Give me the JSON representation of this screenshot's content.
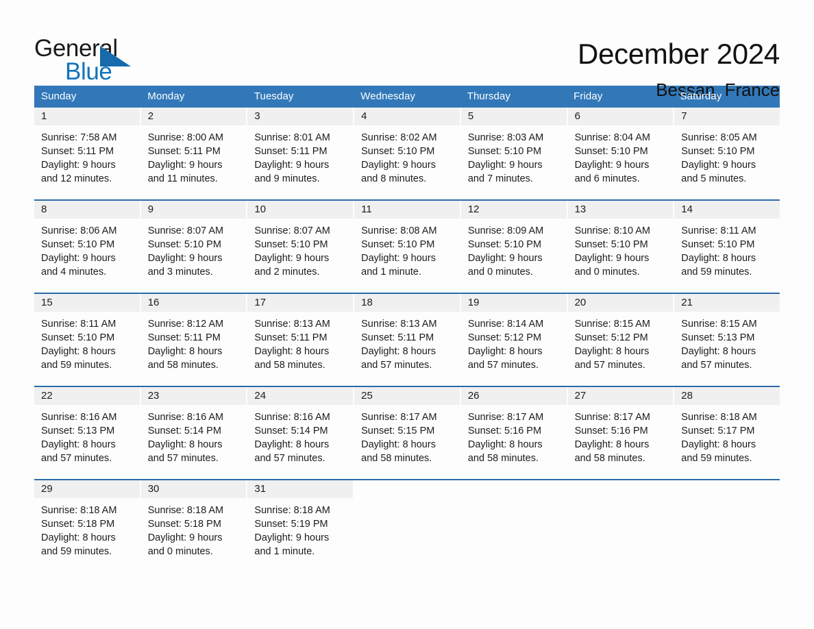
{
  "brand": {
    "name_part1": "General",
    "name_part2": "Blue",
    "accent_color": "#176aab",
    "blue_text_color": "#1273bd"
  },
  "header": {
    "month_title": "December 2024",
    "location": "Bessan, France"
  },
  "calendar": {
    "header_bg": "#3278b8",
    "row_divider_color": "#2b6ca8",
    "daynum_band_bg": "#f0f0f0",
    "weekdays": [
      "Sunday",
      "Monday",
      "Tuesday",
      "Wednesday",
      "Thursday",
      "Friday",
      "Saturday"
    ],
    "weeks": [
      [
        {
          "day": "1",
          "sunrise": "Sunrise: 7:58 AM",
          "sunset": "Sunset: 5:11 PM",
          "daylight_line1": "Daylight: 9 hours",
          "daylight_line2": "and 12 minutes."
        },
        {
          "day": "2",
          "sunrise": "Sunrise: 8:00 AM",
          "sunset": "Sunset: 5:11 PM",
          "daylight_line1": "Daylight: 9 hours",
          "daylight_line2": "and 11 minutes."
        },
        {
          "day": "3",
          "sunrise": "Sunrise: 8:01 AM",
          "sunset": "Sunset: 5:11 PM",
          "daylight_line1": "Daylight: 9 hours",
          "daylight_line2": "and 9 minutes."
        },
        {
          "day": "4",
          "sunrise": "Sunrise: 8:02 AM",
          "sunset": "Sunset: 5:10 PM",
          "daylight_line1": "Daylight: 9 hours",
          "daylight_line2": "and 8 minutes."
        },
        {
          "day": "5",
          "sunrise": "Sunrise: 8:03 AM",
          "sunset": "Sunset: 5:10 PM",
          "daylight_line1": "Daylight: 9 hours",
          "daylight_line2": "and 7 minutes."
        },
        {
          "day": "6",
          "sunrise": "Sunrise: 8:04 AM",
          "sunset": "Sunset: 5:10 PM",
          "daylight_line1": "Daylight: 9 hours",
          "daylight_line2": "and 6 minutes."
        },
        {
          "day": "7",
          "sunrise": "Sunrise: 8:05 AM",
          "sunset": "Sunset: 5:10 PM",
          "daylight_line1": "Daylight: 9 hours",
          "daylight_line2": "and 5 minutes."
        }
      ],
      [
        {
          "day": "8",
          "sunrise": "Sunrise: 8:06 AM",
          "sunset": "Sunset: 5:10 PM",
          "daylight_line1": "Daylight: 9 hours",
          "daylight_line2": "and 4 minutes."
        },
        {
          "day": "9",
          "sunrise": "Sunrise: 8:07 AM",
          "sunset": "Sunset: 5:10 PM",
          "daylight_line1": "Daylight: 9 hours",
          "daylight_line2": "and 3 minutes."
        },
        {
          "day": "10",
          "sunrise": "Sunrise: 8:07 AM",
          "sunset": "Sunset: 5:10 PM",
          "daylight_line1": "Daylight: 9 hours",
          "daylight_line2": "and 2 minutes."
        },
        {
          "day": "11",
          "sunrise": "Sunrise: 8:08 AM",
          "sunset": "Sunset: 5:10 PM",
          "daylight_line1": "Daylight: 9 hours",
          "daylight_line2": "and 1 minute."
        },
        {
          "day": "12",
          "sunrise": "Sunrise: 8:09 AM",
          "sunset": "Sunset: 5:10 PM",
          "daylight_line1": "Daylight: 9 hours",
          "daylight_line2": "and 0 minutes."
        },
        {
          "day": "13",
          "sunrise": "Sunrise: 8:10 AM",
          "sunset": "Sunset: 5:10 PM",
          "daylight_line1": "Daylight: 9 hours",
          "daylight_line2": "and 0 minutes."
        },
        {
          "day": "14",
          "sunrise": "Sunrise: 8:11 AM",
          "sunset": "Sunset: 5:10 PM",
          "daylight_line1": "Daylight: 8 hours",
          "daylight_line2": "and 59 minutes."
        }
      ],
      [
        {
          "day": "15",
          "sunrise": "Sunrise: 8:11 AM",
          "sunset": "Sunset: 5:10 PM",
          "daylight_line1": "Daylight: 8 hours",
          "daylight_line2": "and 59 minutes."
        },
        {
          "day": "16",
          "sunrise": "Sunrise: 8:12 AM",
          "sunset": "Sunset: 5:11 PM",
          "daylight_line1": "Daylight: 8 hours",
          "daylight_line2": "and 58 minutes."
        },
        {
          "day": "17",
          "sunrise": "Sunrise: 8:13 AM",
          "sunset": "Sunset: 5:11 PM",
          "daylight_line1": "Daylight: 8 hours",
          "daylight_line2": "and 58 minutes."
        },
        {
          "day": "18",
          "sunrise": "Sunrise: 8:13 AM",
          "sunset": "Sunset: 5:11 PM",
          "daylight_line1": "Daylight: 8 hours",
          "daylight_line2": "and 57 minutes."
        },
        {
          "day": "19",
          "sunrise": "Sunrise: 8:14 AM",
          "sunset": "Sunset: 5:12 PM",
          "daylight_line1": "Daylight: 8 hours",
          "daylight_line2": "and 57 minutes."
        },
        {
          "day": "20",
          "sunrise": "Sunrise: 8:15 AM",
          "sunset": "Sunset: 5:12 PM",
          "daylight_line1": "Daylight: 8 hours",
          "daylight_line2": "and 57 minutes."
        },
        {
          "day": "21",
          "sunrise": "Sunrise: 8:15 AM",
          "sunset": "Sunset: 5:13 PM",
          "daylight_line1": "Daylight: 8 hours",
          "daylight_line2": "and 57 minutes."
        }
      ],
      [
        {
          "day": "22",
          "sunrise": "Sunrise: 8:16 AM",
          "sunset": "Sunset: 5:13 PM",
          "daylight_line1": "Daylight: 8 hours",
          "daylight_line2": "and 57 minutes."
        },
        {
          "day": "23",
          "sunrise": "Sunrise: 8:16 AM",
          "sunset": "Sunset: 5:14 PM",
          "daylight_line1": "Daylight: 8 hours",
          "daylight_line2": "and 57 minutes."
        },
        {
          "day": "24",
          "sunrise": "Sunrise: 8:16 AM",
          "sunset": "Sunset: 5:14 PM",
          "daylight_line1": "Daylight: 8 hours",
          "daylight_line2": "and 57 minutes."
        },
        {
          "day": "25",
          "sunrise": "Sunrise: 8:17 AM",
          "sunset": "Sunset: 5:15 PM",
          "daylight_line1": "Daylight: 8 hours",
          "daylight_line2": "and 58 minutes."
        },
        {
          "day": "26",
          "sunrise": "Sunrise: 8:17 AM",
          "sunset": "Sunset: 5:16 PM",
          "daylight_line1": "Daylight: 8 hours",
          "daylight_line2": "and 58 minutes."
        },
        {
          "day": "27",
          "sunrise": "Sunrise: 8:17 AM",
          "sunset": "Sunset: 5:16 PM",
          "daylight_line1": "Daylight: 8 hours",
          "daylight_line2": "and 58 minutes."
        },
        {
          "day": "28",
          "sunrise": "Sunrise: 8:18 AM",
          "sunset": "Sunset: 5:17 PM",
          "daylight_line1": "Daylight: 8 hours",
          "daylight_line2": "and 59 minutes."
        }
      ],
      [
        {
          "day": "29",
          "sunrise": "Sunrise: 8:18 AM",
          "sunset": "Sunset: 5:18 PM",
          "daylight_line1": "Daylight: 8 hours",
          "daylight_line2": "and 59 minutes."
        },
        {
          "day": "30",
          "sunrise": "Sunrise: 8:18 AM",
          "sunset": "Sunset: 5:18 PM",
          "daylight_line1": "Daylight: 9 hours",
          "daylight_line2": "and 0 minutes."
        },
        {
          "day": "31",
          "sunrise": "Sunrise: 8:18 AM",
          "sunset": "Sunset: 5:19 PM",
          "daylight_line1": "Daylight: 9 hours",
          "daylight_line2": "and 1 minute."
        },
        {
          "day": "",
          "sunrise": "",
          "sunset": "",
          "daylight_line1": "",
          "daylight_line2": ""
        },
        {
          "day": "",
          "sunrise": "",
          "sunset": "",
          "daylight_line1": "",
          "daylight_line2": ""
        },
        {
          "day": "",
          "sunrise": "",
          "sunset": "",
          "daylight_line1": "",
          "daylight_line2": ""
        },
        {
          "day": "",
          "sunrise": "",
          "sunset": "",
          "daylight_line1": "",
          "daylight_line2": ""
        }
      ]
    ]
  }
}
